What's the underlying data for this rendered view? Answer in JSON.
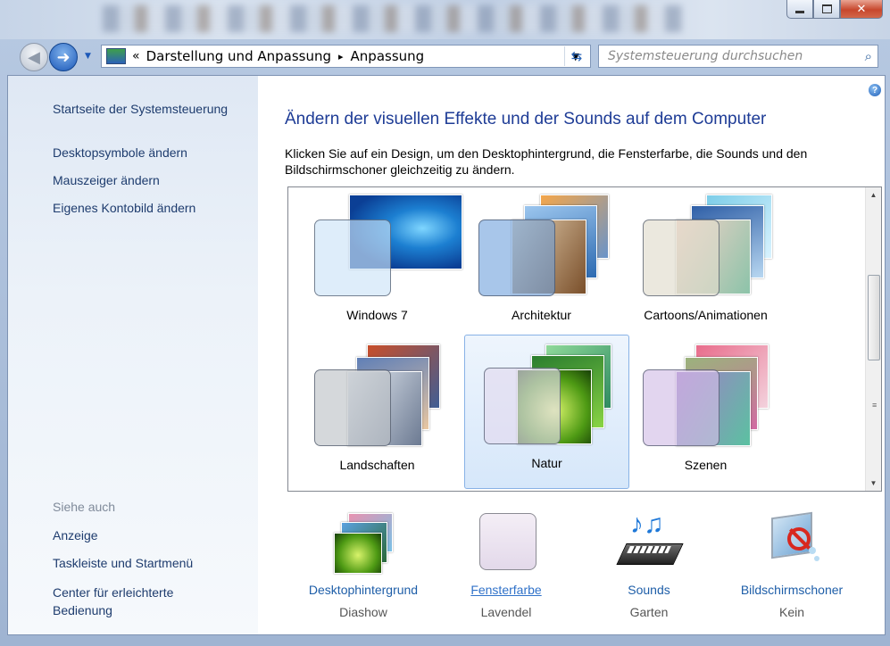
{
  "address": {
    "chevron": "«",
    "crumb1": "Darstellung und Anpassung",
    "arrow": "▸",
    "crumb2": "Anpassung"
  },
  "search": {
    "placeholder": "Systemsteuerung durchsuchen"
  },
  "sidebar": {
    "home": "Startseite der Systemsteuerung",
    "links": [
      "Desktopsymbole ändern",
      "Mauszeiger ändern",
      "Eigenes Kontobild ändern"
    ],
    "see_also_heading": "Siehe auch",
    "see_also": [
      "Anzeige",
      "Taskleiste und Startmenü",
      "Center für erleichterte\nBedienung"
    ]
  },
  "main": {
    "title": "Ändern der visuellen Effekte und der Sounds auf dem Computer",
    "description": "Klicken Sie auf ein Design, um den Desktophintergrund, die Fensterfarbe, die Sounds und den Bildschirmschoner gleichzeitig zu ändern.",
    "themes": [
      {
        "label": "Windows 7",
        "selected": false
      },
      {
        "label": "Architektur",
        "selected": false
      },
      {
        "label": "Cartoons/Animationen",
        "selected": false
      },
      {
        "label": "Landschaften",
        "selected": false
      },
      {
        "label": "Natur",
        "selected": true
      },
      {
        "label": "Szenen",
        "selected": false
      }
    ],
    "settings": [
      {
        "label": "Desktophintergrund",
        "value": "Diashow"
      },
      {
        "label": "Fensterfarbe",
        "value": "Lavendel"
      },
      {
        "label": "Sounds",
        "value": "Garten"
      },
      {
        "label": "Bildschirmschoner",
        "value": "Kein"
      }
    ]
  },
  "colors": {
    "link": "#1e3c6e",
    "title": "#1e3c96",
    "selection": "#d6e7fa",
    "lavender": "#e9e0ee"
  },
  "icons": [
    "back-arrow-icon",
    "forward-arrow-icon",
    "control-panel-icon",
    "refresh-icon",
    "search-icon",
    "help-icon",
    "minimize-icon",
    "maximize-icon",
    "close-icon"
  ]
}
